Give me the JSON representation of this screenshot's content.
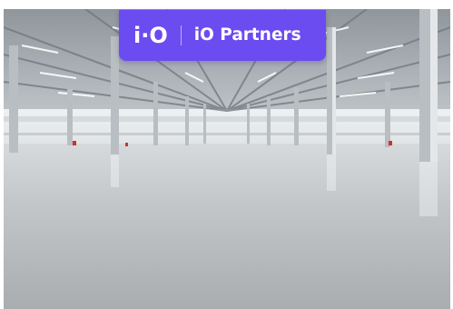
{
  "brand": {
    "logo_text": "i·O",
    "name": "iO Partners",
    "badge_color": "#6b4cf0"
  },
  "photo": {
    "subject": "warehouse-interior-photo"
  }
}
